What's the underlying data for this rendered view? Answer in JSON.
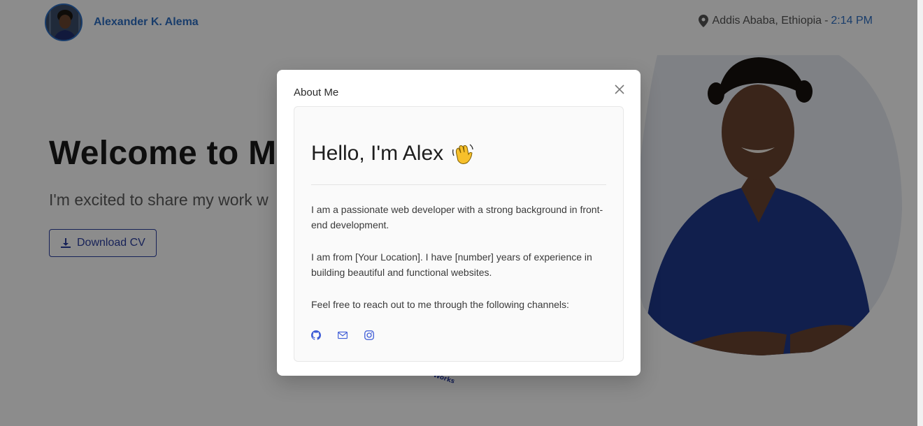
{
  "header": {
    "name": "Alexander K. Alema",
    "location": "Addis Ababa, Ethiopia",
    "separator": "-",
    "time": "2:14 PM"
  },
  "hero": {
    "title": "Welcome to M",
    "subtitle": "I'm excited to share my work w",
    "cv_button_label": "Download CV"
  },
  "badge": {
    "text": "Works"
  },
  "modal": {
    "title": "About Me",
    "heading": "Hello, I'm Alex",
    "heading_emoji": "👋",
    "paragraphs": [
      "I am a passionate web developer with a strong background in front-end development.",
      "I am from [Your Location]. I have [number] years of experience in building beautiful and functional websites.",
      "Feel free to reach out to me through the following channels:"
    ],
    "socials": [
      "github-icon",
      "mail-icon",
      "instagram-icon"
    ]
  },
  "colors": {
    "accent": "#2f6fc4",
    "button": "#2b3ea0",
    "shirt": "#1f3a8c",
    "social_icons": "#3d5bd6"
  }
}
